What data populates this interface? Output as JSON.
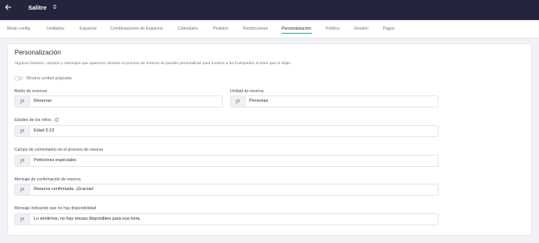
{
  "header": {
    "back_icon": "arrow-left-icon",
    "venue_name": "Salitre",
    "venue_selector_icon": "up-down-caret-icon"
  },
  "tabs": [
    {
      "label": "Modo config.",
      "active": false
    },
    {
      "label": "Unidades",
      "active": false
    },
    {
      "label": "Espacios",
      "active": false
    },
    {
      "label": "Combinaciones de Espacios",
      "active": false
    },
    {
      "label": "Calendario",
      "active": false
    },
    {
      "label": "Pedidos",
      "active": false
    },
    {
      "label": "Restricciones",
      "active": false
    },
    {
      "label": "Personalización",
      "active": true
    },
    {
      "label": "Política",
      "active": false
    },
    {
      "label": "Gestión",
      "active": false
    },
    {
      "label": "Pagos",
      "active": false
    }
  ],
  "accent_color": "#3aa39a",
  "main": {
    "title": "Personalización",
    "description": "Algunos botones, campos y mensajes que aparecen durante el proceso de reserva se pueden personalizar para mostrar a los huéspedes el texto que tú elijas.",
    "toggle": {
      "label": "Mostrar unidad asignada",
      "on": false
    },
    "fields": {
      "reserve_button": {
        "label": "Botón de reservar",
        "value": "Reservar"
      },
      "reservation_unit": {
        "label": "Unidad de reserva",
        "value": "Personas"
      },
      "child_ages": {
        "label": "Edades de los niños",
        "value": "Edad 3-12",
        "info_icon": "info-icon"
      },
      "comments_field": {
        "label": "Campo de comentarios en el proceso de reserva",
        "value": "Peticiones especiales"
      },
      "confirmation_message": {
        "label": "Mensaje de confirmación de reserva",
        "value": "Reserva confirmada. ¡Gracias!"
      },
      "unavailable_message": {
        "label": "Mensaje indicando que no hay disponibilidad",
        "value": "Lo sentimos, no hay mesas disponibles para esa hora."
      }
    },
    "flag_icon": "flag-icon"
  }
}
